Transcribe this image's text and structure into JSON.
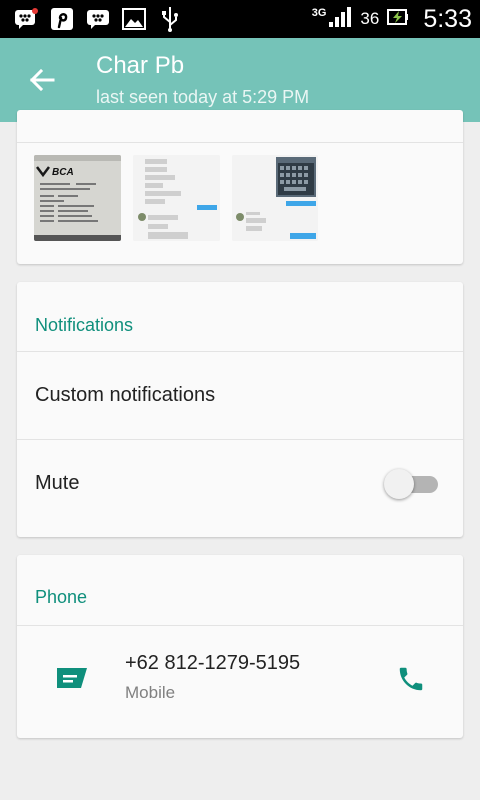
{
  "status_bar": {
    "left_icons": [
      "bbm-notification-icon",
      "pinterest-icon",
      "bbm-icon",
      "image-icon",
      "usb-icon"
    ],
    "network": "3G",
    "battery_level": "36",
    "time": "5:33"
  },
  "header": {
    "title": "Char Pb",
    "subtitle": "last seen today at 5:29 PM"
  },
  "media": {
    "thumb1_logo": "BCA"
  },
  "notifications": {
    "heading": "Notifications",
    "custom_label": "Custom notifications",
    "mute_label": "Mute",
    "mute_on": false
  },
  "phone": {
    "heading": "Phone",
    "number": "+62 812-1279-5195",
    "type": "Mobile"
  },
  "colors": {
    "appbar": "#75c3b8",
    "accent": "#0f8f7c"
  }
}
